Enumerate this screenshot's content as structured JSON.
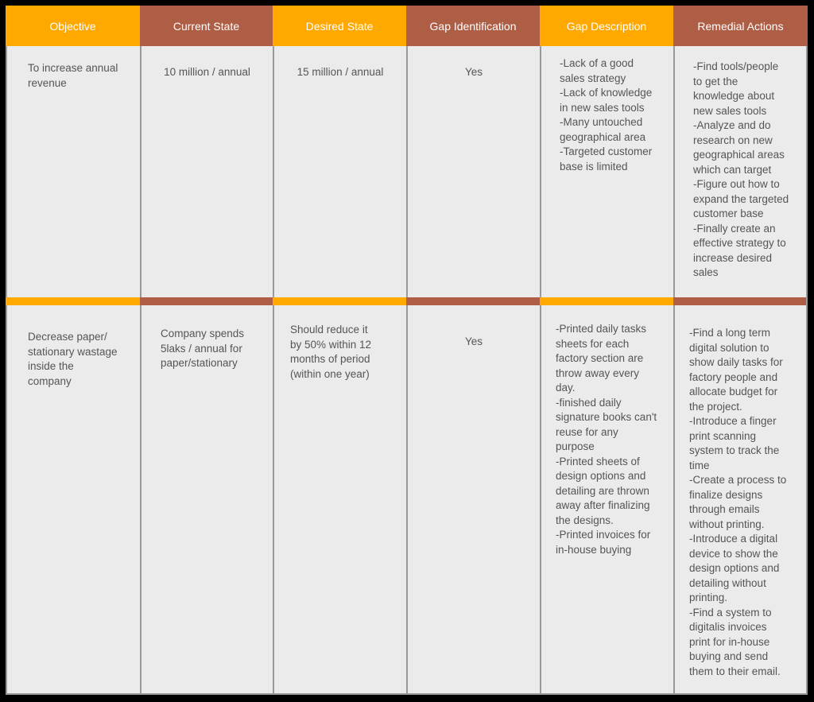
{
  "colors": {
    "orange": "#ffa800",
    "brown": "#ad5e45",
    "cell_background": "#ebebeb",
    "grid_line": "#999999",
    "text": "#555555"
  },
  "headers": [
    "Objective",
    "Current State",
    "Desired State",
    "Gap Identification",
    "Gap Description",
    "Remedial Actions"
  ],
  "rows": [
    {
      "objective": "To increase annual\nrevenue",
      "current_state": "10 million / annual",
      "desired_state": "15 million / annual",
      "gap_identification": "Yes",
      "gap_description": "-Lack of a good\nsales strategy\n-Lack of knowledge\nin new sales tools\n-Many untouched\ngeographical area\n-Targeted customer\nbase is limited",
      "remedial_actions": "-Find tools/people\nto get the\nknowledge about\nnew sales tools\n-Analyze and do\nresearch on new\ngeographical areas\nwhich can target\n-Figure out how to\nexpand the targeted\ncustomer base\n-Finally create an\neffective strategy to\nincrease desired\nsales"
    },
    {
      "objective": "Decrease paper/\nstationary wastage\ninside the\ncompany",
      "current_state": "Company spends\n5laks / annual for\npaper/stationary",
      "desired_state": "Should reduce it\nby 50% within 12\nmonths of period\n(within one year)",
      "gap_identification": "Yes",
      "gap_description": "-Printed daily tasks\nsheets for each\nfactory section are\nthrow away every\nday.\n-finished daily\nsignature books can't\nreuse for any\npurpose\n-Printed sheets of\ndesign options and\ndetailing are thrown\naway after finalizing\nthe designs.\n-Printed invoices for\nin-house buying",
      "remedial_actions": "-Find a long term\ndigital solution to\nshow daily tasks for\nfactory people and\nallocate budget for\nthe project.\n-Introduce a finger\nprint scanning\nsystem to track the\ntime\n-Create a process to\nfinalize designs\nthrough emails\nwithout printing.\n-Introduce a digital\ndevice to show the\ndesign options and\ndetailing without\nprinting.\n-Find a system to\ndigitalis invoices\nprint for in-house\nbuying and send\nthem to their email."
    }
  ]
}
